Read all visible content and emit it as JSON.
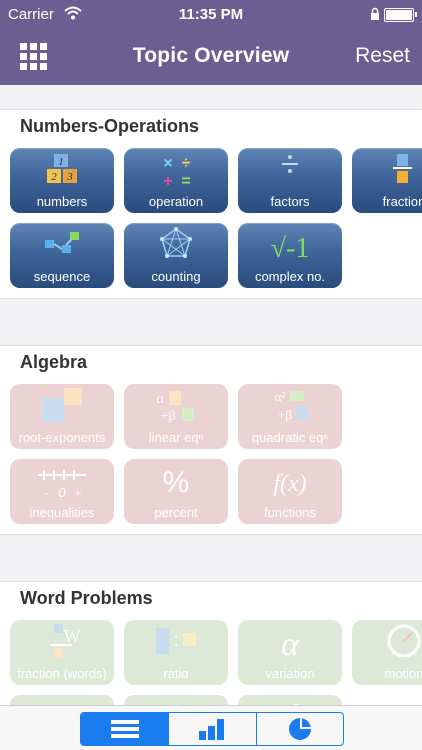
{
  "status": {
    "carrier": "Carrier",
    "time": "11:35 PM"
  },
  "nav": {
    "title": "Topic Overview",
    "reset_label": "Reset",
    "menu_icon": "grid-icon"
  },
  "sections": [
    {
      "title": "Numbers-Operations",
      "state": "active",
      "tiles": [
        {
          "label": "numbers",
          "icon": "numbers-icon"
        },
        {
          "label": "operation",
          "icon": "operation-icon"
        },
        {
          "label": "factors",
          "icon": "factors-icon"
        },
        {
          "label": "fraction",
          "icon": "fraction-icon"
        },
        {
          "label": "sequence",
          "icon": "sequence-icon"
        },
        {
          "label": "counting",
          "icon": "counting-icon"
        },
        {
          "label": "complex no.",
          "icon": "complex-icon"
        }
      ]
    },
    {
      "title": "Algebra",
      "state": "disabled",
      "tiles": [
        {
          "label": "root-exponents",
          "icon": "root-exponents-icon"
        },
        {
          "label": "linear eqⁿ",
          "icon": "linear-eq-icon"
        },
        {
          "label": "quadratic eqⁿ",
          "icon": "quadratic-eq-icon"
        },
        {
          "label": "inequalities",
          "icon": "inequalities-icon"
        },
        {
          "label": "percent",
          "icon": "percent-icon"
        },
        {
          "label": "functions",
          "icon": "functions-icon"
        }
      ]
    },
    {
      "title": "Word Problems",
      "state": "disabled",
      "tiles": [
        {
          "label": "fraction (words)",
          "icon": "fraction-words-icon"
        },
        {
          "label": "ratio",
          "icon": "ratio-icon"
        },
        {
          "label": "variation",
          "icon": "variation-icon"
        },
        {
          "label": "motion",
          "icon": "motion-icon"
        },
        {
          "label": "",
          "icon": "gears-icon"
        },
        {
          "label": "",
          "icon": "people-icon"
        },
        {
          "label": "",
          "icon": "group-icon"
        }
      ]
    }
  ],
  "icon_text": {
    "num_1": "1",
    "num_2": "2",
    "num_3": "3",
    "root": "√-1",
    "percent": "%",
    "fx": "f(x)",
    "alpha": "α",
    "beta": "β",
    "alpha_sq": "α²",
    "plus": "+",
    "minus": "-",
    "zero": "0",
    "w": "W",
    "ratio_colon": ":"
  },
  "tabbar": {
    "tabs": [
      {
        "icon": "list-icon",
        "selected": true
      },
      {
        "icon": "bar-chart-icon",
        "selected": false
      },
      {
        "icon": "pie-chart-icon",
        "selected": false
      }
    ]
  },
  "colors": {
    "nav": "#6a5f90",
    "tile_blue": "#3f6499",
    "tile_red_disabled": "#ecd3d3",
    "tile_green_disabled": "#dce9d6",
    "accent": "#1b7cf0"
  }
}
